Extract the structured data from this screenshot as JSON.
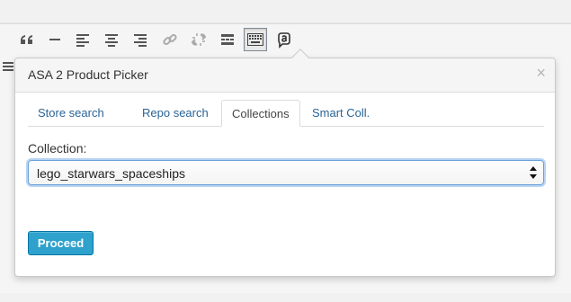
{
  "toolbar": {
    "icons": [
      "unordered-list-icon",
      "blockquote-icon",
      "horizontal-rule-icon",
      "align-left-icon",
      "align-center-icon",
      "align-right-icon",
      "insert-link-icon",
      "remove-link-icon",
      "read-more-icon",
      "toolbar-toggle-icon",
      "asa-product-picker-icon",
      "row2-formatting-icon"
    ]
  },
  "popup": {
    "title": "ASA 2 Product Picker",
    "close_label": "×",
    "tabs": [
      {
        "label": "Store search",
        "active": false
      },
      {
        "label": "Repo search",
        "active": false
      },
      {
        "label": "Collections",
        "active": true
      },
      {
        "label": "Smart Coll.",
        "active": false
      }
    ],
    "collection_label": "Collection:",
    "collection_value": "lego_starwars_spaceships",
    "proceed_label": "Proceed"
  },
  "colors": {
    "primary_button": "#2ea2cc",
    "link": "#2a6496",
    "focus_ring": "#6aa1d8"
  }
}
